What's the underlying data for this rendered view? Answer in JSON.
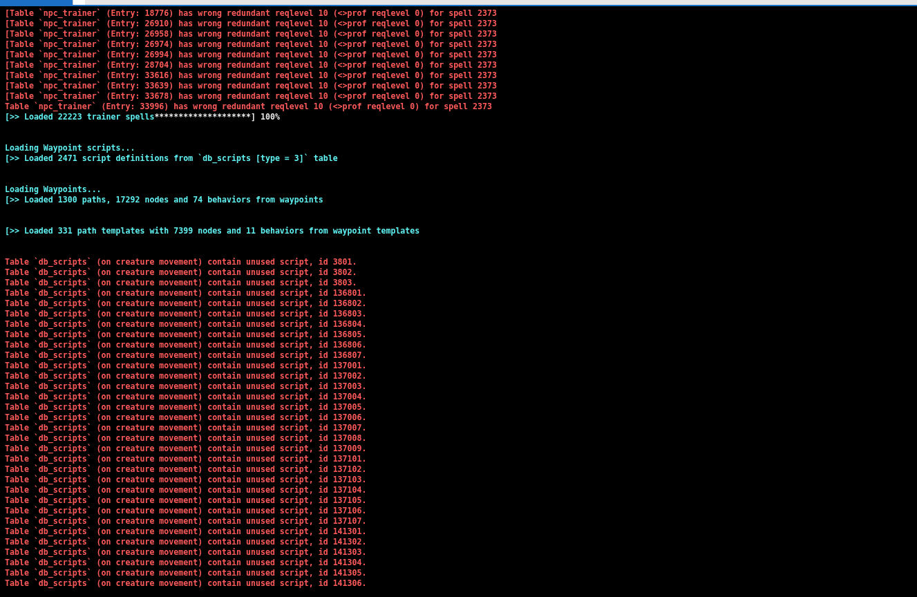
{
  "blocks": [
    {
      "lines": [
        [
          {
            "kind": "error",
            "text": "[Table `npc_trainer` (Entry: 18776) has wrong redundant reqlevel 10 (<>prof reqlevel 0) for spell 2373"
          }
        ],
        [
          {
            "kind": "error",
            "text": "[Table `npc_trainer` (Entry: 26910) has wrong redundant reqlevel 10 (<>prof reqlevel 0) for spell 2373"
          }
        ],
        [
          {
            "kind": "error",
            "text": "[Table `npc_trainer` (Entry: 26958) has wrong redundant reqlevel 10 (<>prof reqlevel 0) for spell 2373"
          }
        ],
        [
          {
            "kind": "error",
            "text": "[Table `npc_trainer` (Entry: 26974) has wrong redundant reqlevel 10 (<>prof reqlevel 0) for spell 2373"
          }
        ],
        [
          {
            "kind": "error",
            "text": "[Table `npc_trainer` (Entry: 26994) has wrong redundant reqlevel 10 (<>prof reqlevel 0) for spell 2373"
          }
        ],
        [
          {
            "kind": "error",
            "text": "[Table `npc_trainer` (Entry: 28704) has wrong redundant reqlevel 10 (<>prof reqlevel 0) for spell 2373"
          }
        ],
        [
          {
            "kind": "error",
            "text": "[Table `npc_trainer` (Entry: 33616) has wrong redundant reqlevel 10 (<>prof reqlevel 0) for spell 2373"
          }
        ],
        [
          {
            "kind": "error",
            "text": "[Table `npc_trainer` (Entry: 33639) has wrong redundant reqlevel 10 (<>prof reqlevel 0) for spell 2373"
          }
        ],
        [
          {
            "kind": "error",
            "text": "[Table `npc_trainer` (Entry: 33678) has wrong redundant reqlevel 10 (<>prof reqlevel 0) for spell 2373"
          }
        ],
        [
          {
            "kind": "error",
            "text": "Table `npc_trainer` (Entry: 33996) has wrong redundant reqlevel 10 (<>prof reqlevel 0) for spell 2373"
          }
        ],
        [
          {
            "kind": "info",
            "text": "[>> Loaded 22223 trainer spells"
          },
          {
            "kind": "plain",
            "text": "********************] 100%"
          }
        ]
      ]
    },
    {
      "lines": [
        [
          {
            "kind": "info",
            "text": "Loading Waypoint scripts..."
          }
        ],
        [
          {
            "kind": "info",
            "text": "[>> Loaded 2471 script definitions from `db_scripts [type = 3]` table"
          }
        ]
      ]
    },
    {
      "lines": [
        [
          {
            "kind": "info",
            "text": "Loading Waypoints..."
          }
        ],
        [
          {
            "kind": "info",
            "text": "[>> Loaded 1300 paths, 17292 nodes and 74 behaviors from waypoints"
          }
        ]
      ]
    },
    {
      "lines": [
        [
          {
            "kind": "info",
            "text": "[>> Loaded 331 path templates with 7399 nodes and 11 behaviors from waypoint templates"
          }
        ]
      ]
    },
    {
      "lines": [
        [
          {
            "kind": "error",
            "text": "Table `db_scripts` (on creature movement) contain unused script, id 3801."
          }
        ],
        [
          {
            "kind": "error",
            "text": "Table `db_scripts` (on creature movement) contain unused script, id 3802."
          }
        ],
        [
          {
            "kind": "error",
            "text": "Table `db_scripts` (on creature movement) contain unused script, id 3803."
          }
        ],
        [
          {
            "kind": "error",
            "text": "Table `db_scripts` (on creature movement) contain unused script, id 136801."
          }
        ],
        [
          {
            "kind": "error",
            "text": "Table `db_scripts` (on creature movement) contain unused script, id 136802."
          }
        ],
        [
          {
            "kind": "error",
            "text": "Table `db_scripts` (on creature movement) contain unused script, id 136803."
          }
        ],
        [
          {
            "kind": "error",
            "text": "Table `db_scripts` (on creature movement) contain unused script, id 136804."
          }
        ],
        [
          {
            "kind": "error",
            "text": "Table `db_scripts` (on creature movement) contain unused script, id 136805."
          }
        ],
        [
          {
            "kind": "error",
            "text": "Table `db_scripts` (on creature movement) contain unused script, id 136806."
          }
        ],
        [
          {
            "kind": "error",
            "text": "Table `db_scripts` (on creature movement) contain unused script, id 136807."
          }
        ],
        [
          {
            "kind": "error",
            "text": "Table `db_scripts` (on creature movement) contain unused script, id 137001."
          }
        ],
        [
          {
            "kind": "error",
            "text": "Table `db_scripts` (on creature movement) contain unused script, id 137002."
          }
        ],
        [
          {
            "kind": "error",
            "text": "Table `db_scripts` (on creature movement) contain unused script, id 137003."
          }
        ],
        [
          {
            "kind": "error",
            "text": "Table `db_scripts` (on creature movement) contain unused script, id 137004."
          }
        ],
        [
          {
            "kind": "error",
            "text": "Table `db_scripts` (on creature movement) contain unused script, id 137005."
          }
        ],
        [
          {
            "kind": "error",
            "text": "Table `db_scripts` (on creature movement) contain unused script, id 137006."
          }
        ],
        [
          {
            "kind": "error",
            "text": "Table `db_scripts` (on creature movement) contain unused script, id 137007."
          }
        ],
        [
          {
            "kind": "error",
            "text": "Table `db_scripts` (on creature movement) contain unused script, id 137008."
          }
        ],
        [
          {
            "kind": "error",
            "text": "Table `db_scripts` (on creature movement) contain unused script, id 137009."
          }
        ],
        [
          {
            "kind": "error",
            "text": "Table `db_scripts` (on creature movement) contain unused script, id 137101."
          }
        ],
        [
          {
            "kind": "error",
            "text": "Table `db_scripts` (on creature movement) contain unused script, id 137102."
          }
        ],
        [
          {
            "kind": "error",
            "text": "Table `db_scripts` (on creature movement) contain unused script, id 137103."
          }
        ],
        [
          {
            "kind": "error",
            "text": "Table `db_scripts` (on creature movement) contain unused script, id 137104."
          }
        ],
        [
          {
            "kind": "error",
            "text": "Table `db_scripts` (on creature movement) contain unused script, id 137105."
          }
        ],
        [
          {
            "kind": "error",
            "text": "Table `db_scripts` (on creature movement) contain unused script, id 137106."
          }
        ],
        [
          {
            "kind": "error",
            "text": "Table `db_scripts` (on creature movement) contain unused script, id 137107."
          }
        ],
        [
          {
            "kind": "error",
            "text": "Table `db_scripts` (on creature movement) contain unused script, id 141301."
          }
        ],
        [
          {
            "kind": "error",
            "text": "Table `db_scripts` (on creature movement) contain unused script, id 141302."
          }
        ],
        [
          {
            "kind": "error",
            "text": "Table `db_scripts` (on creature movement) contain unused script, id 141303."
          }
        ],
        [
          {
            "kind": "error",
            "text": "Table `db_scripts` (on creature movement) contain unused script, id 141304."
          }
        ],
        [
          {
            "kind": "error",
            "text": "Table `db_scripts` (on creature movement) contain unused script, id 141305."
          }
        ],
        [
          {
            "kind": "error",
            "text": "Table `db_scripts` (on creature movement) contain unused script, id 141306."
          }
        ]
      ]
    }
  ]
}
